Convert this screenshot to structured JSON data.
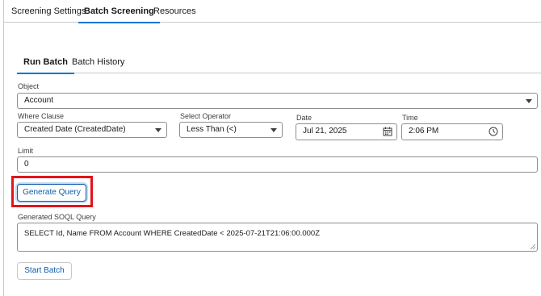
{
  "top_tabs": [
    "Screening Settings",
    "Batch Screening",
    "Resources"
  ],
  "sub_tabs": [
    "Run Batch",
    "Batch History"
  ],
  "form": {
    "object_label": "Object",
    "object_value": "Account",
    "where_label": "Where Clause",
    "where_value": "Created Date (CreatedDate)",
    "operator_label": "Select Operator",
    "operator_value": "Less Than (<)",
    "date_label": "Date",
    "date_value": "Jul 21, 2025",
    "time_label": "Time",
    "time_value": "2:06 PM",
    "limit_label": "Limit",
    "limit_value": "0",
    "generate_label": "Generate Query",
    "soql_label": "Generated SOQL Query",
    "soql_value": "SELECT Id, Name FROM Account WHERE CreatedDate < 2025-07-21T21:06:00.000Z",
    "start_label": "Start Batch"
  },
  "colors": {
    "accent": "#0176d3",
    "button_text": "#0b5cab",
    "highlight": "#e3131b"
  },
  "icons": {
    "dropdown": "chevron-down-icon",
    "date": "calendar-icon",
    "time": "clock-icon"
  }
}
